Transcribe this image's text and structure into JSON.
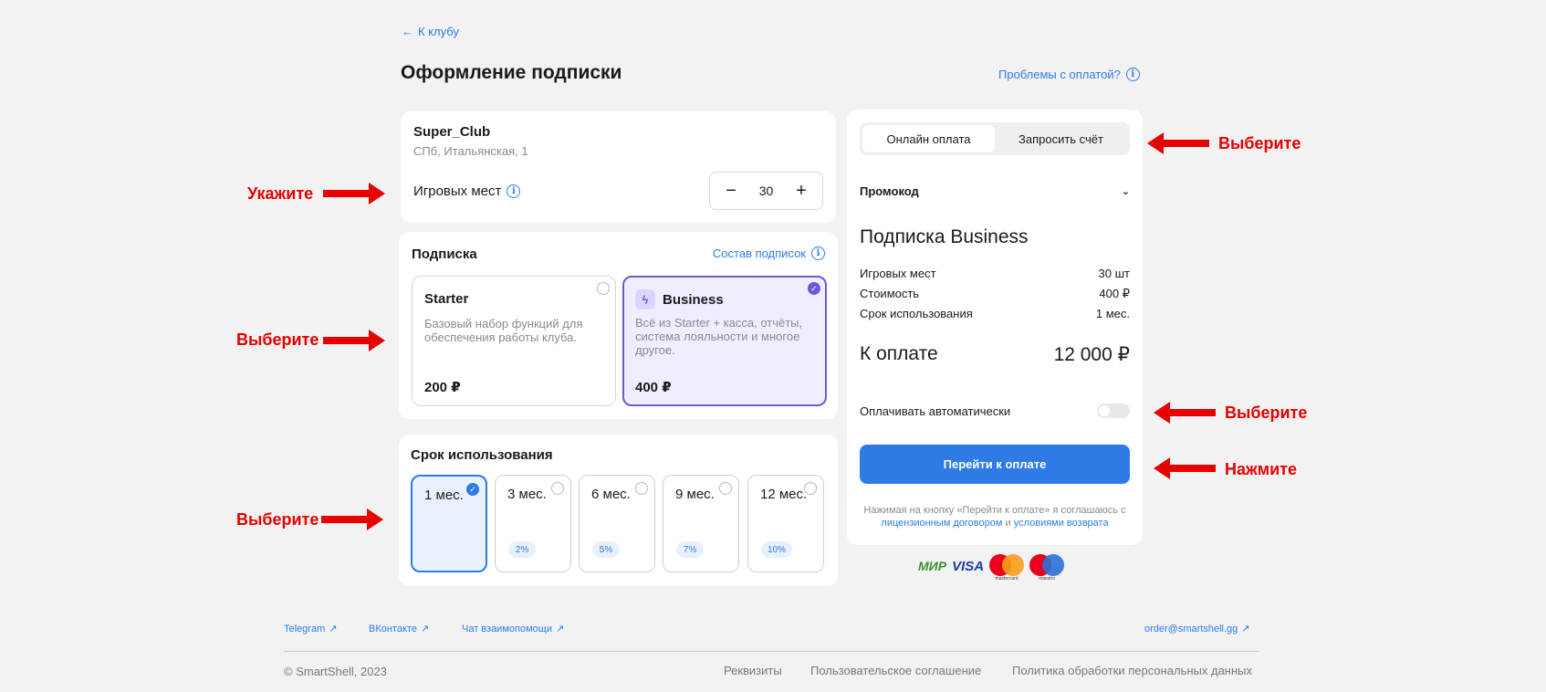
{
  "nav": {
    "back_label": "К клубу"
  },
  "header": {
    "title": "Оформление подписки",
    "help_label": "Проблемы с оплатой?"
  },
  "club": {
    "name": "Super_Club",
    "address": "СПб, Итальянская, 1",
    "seats_label": "Игровых мест",
    "seats_value": "30",
    "minus": "−",
    "plus": "+"
  },
  "subscription": {
    "title": "Подписка",
    "compose_label": "Состав подписок",
    "plans": [
      {
        "name": "Starter",
        "description": "Базовый набор функций для обеспечения работы клуба.",
        "price": "200 ₽",
        "selected": false
      },
      {
        "name": "Business",
        "description": "Всё из Starter + касса, отчёты, система лояльности и многое другое.",
        "price": "400 ₽",
        "selected": true
      }
    ]
  },
  "term": {
    "title": "Срок использования",
    "options": [
      {
        "label": "1 мес.",
        "discount": "",
        "selected": true
      },
      {
        "label": "3 мес.",
        "discount": "2%",
        "selected": false
      },
      {
        "label": "6 мес.",
        "discount": "5%",
        "selected": false
      },
      {
        "label": "9 мес.",
        "discount": "7%",
        "selected": false
      },
      {
        "label": "12 мес.",
        "discount": "10%",
        "selected": false
      }
    ]
  },
  "summary": {
    "tabs": [
      "Онлайн оплата",
      "Запросить счёт"
    ],
    "active_tab": 0,
    "promo_label": "Промокод",
    "plan_title": "Подписка Business",
    "rows": [
      {
        "label": "Игровых мест",
        "value": "30 шт"
      },
      {
        "label": "Стоимость",
        "value": "400 ₽"
      },
      {
        "label": "Срок использования",
        "value": "1 мес."
      }
    ],
    "total_label": "К оплате",
    "total_value": "12 000 ₽",
    "auto_label": "Оплачивать автоматически",
    "pay_button": "Перейти к оплате",
    "legal_prefix": "Нажимая на кнопку «Перейти к оплате» я соглашаюсь с",
    "legal_link1": "лицензионным договором",
    "legal_and": "и",
    "legal_link2": "условиями возврата"
  },
  "payment_icons": {
    "mir": "МИР",
    "visa": "VISA",
    "mastercard": "mastercard",
    "maestro": "maestro"
  },
  "annotations": {
    "specify": "Укажите",
    "choose": "Выберите",
    "press": "Нажмите"
  },
  "footer": {
    "links": [
      "Telegram",
      "ВКонтакте",
      "Чат взаимопомощи"
    ],
    "email": "order@smartshell.gg",
    "copyright": "© SmartShell, 2023",
    "right_links": [
      "Реквизиты",
      "Пользовательское соглашение",
      "Политика обработки персональных данных"
    ]
  },
  "colors": {
    "accent": "#2e7be6",
    "plan_selected": "#6b5ad8",
    "annotation": "#e60000"
  },
  "icons": {
    "back": "arrow-left-icon",
    "info": "info-icon",
    "chevron": "chevron-down-icon",
    "external": "arrow-up-right-icon",
    "bolt": "bolt-icon",
    "check": "check-icon"
  }
}
